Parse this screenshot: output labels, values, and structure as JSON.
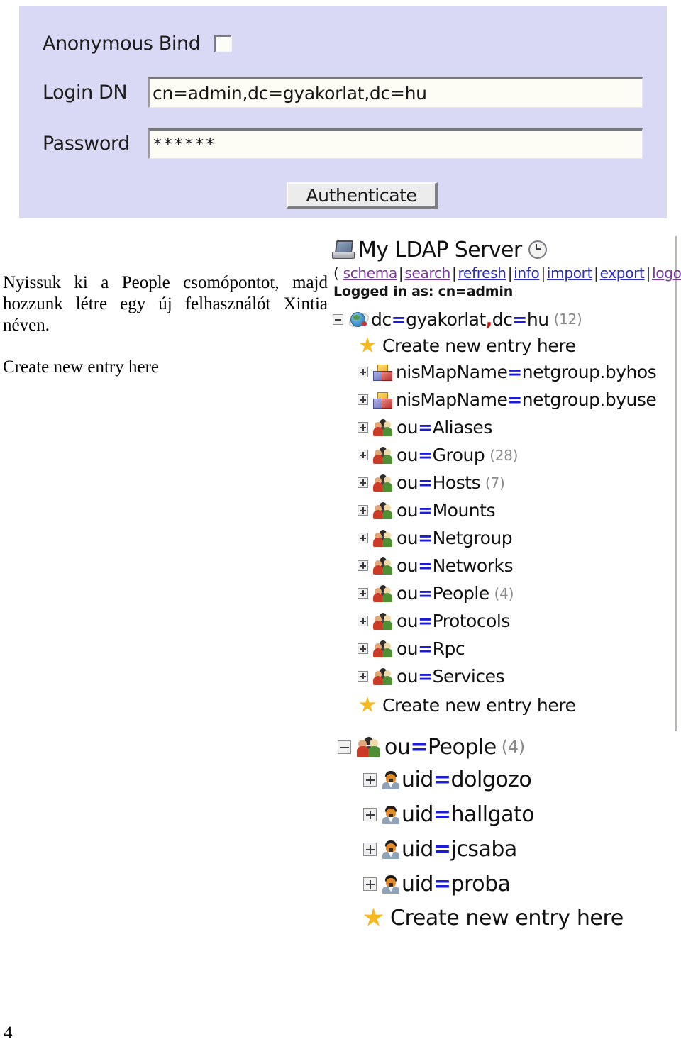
{
  "auth_form": {
    "anonymous_bind_label": "Anonymous Bind",
    "anonymous_bind_checked": false,
    "login_dn_label": "Login DN",
    "login_dn_value": "cn=admin,dc=gyakorlat,dc=hu",
    "password_label": "Password",
    "password_value": "******",
    "authenticate_label": "Authenticate",
    "panel_background": "#d9d9f5"
  },
  "body_text": {
    "paragraph_1": "Nyissuk ki a People csomópontot, majd hozzunk létre egy új felhasználót Xintia néven.",
    "paragraph_2": "Create new entry here"
  },
  "ldap": {
    "server_title": "My LDAP Server",
    "server_icon": "computer-icon",
    "clock_icon": "clock-icon",
    "nav_open_paren": "(",
    "nav_close_paren": ")",
    "nav_separator": "|",
    "nav_links": [
      {
        "label": "schema",
        "state": "visited"
      },
      {
        "label": "search",
        "state": "visited"
      },
      {
        "label": "refresh",
        "state": "fresh"
      },
      {
        "label": "info",
        "state": "fresh"
      },
      {
        "label": "import",
        "state": "fresh"
      },
      {
        "label": "export",
        "state": "fresh"
      },
      {
        "label": "logout",
        "state": "visited"
      }
    ],
    "logged_in_as": "Logged in as: cn=admin",
    "link_visited_color": "#7b38a0",
    "link_color": "#2b2bc8",
    "equals_color": "#1b1bd8",
    "comma_color": "#cc1111",
    "count_color": "#8a8a8a",
    "create_entry_label": "Create new entry here",
    "root": {
      "toggle": "minus",
      "attr": "dc",
      "value": "gyakorlat,dc=hu",
      "text_dc1": "dc",
      "text_gyakorlat": "gyakorlat",
      "text_dc2": "dc",
      "text_hu": "hu",
      "count": "(12)"
    },
    "children": [
      {
        "toggle": "plus",
        "icon": "cubes-icon",
        "attr": "nisMapName",
        "value": "netgroup.byhos",
        "count": ""
      },
      {
        "toggle": "plus",
        "icon": "cubes-icon",
        "attr": "nisMapName",
        "value": "netgroup.byuse",
        "count": ""
      },
      {
        "toggle": "plus",
        "icon": "group-icon",
        "attr": "ou",
        "value": "Aliases",
        "count": ""
      },
      {
        "toggle": "plus",
        "icon": "group-icon",
        "attr": "ou",
        "value": "Group",
        "count": "(28)"
      },
      {
        "toggle": "plus",
        "icon": "group-icon",
        "attr": "ou",
        "value": "Hosts",
        "count": "(7)"
      },
      {
        "toggle": "plus",
        "icon": "group-icon",
        "attr": "ou",
        "value": "Mounts",
        "count": ""
      },
      {
        "toggle": "plus",
        "icon": "group-icon",
        "attr": "ou",
        "value": "Netgroup",
        "count": ""
      },
      {
        "toggle": "plus",
        "icon": "group-icon",
        "attr": "ou",
        "value": "Networks",
        "count": ""
      },
      {
        "toggle": "plus",
        "icon": "group-icon",
        "attr": "ou",
        "value": "People",
        "count": "(4)"
      },
      {
        "toggle": "plus",
        "icon": "group-icon",
        "attr": "ou",
        "value": "Protocols",
        "count": ""
      },
      {
        "toggle": "plus",
        "icon": "group-icon",
        "attr": "ou",
        "value": "Rpc",
        "count": ""
      },
      {
        "toggle": "plus",
        "icon": "group-icon",
        "attr": "ou",
        "value": "Services",
        "count": ""
      }
    ],
    "people_section": {
      "toggle": "minus",
      "icon": "group-icon",
      "attr": "ou",
      "value": "People",
      "count": "(4)",
      "users": [
        {
          "toggle": "plus",
          "icon": "person-icon",
          "attr": "uid",
          "value": "dolgozo"
        },
        {
          "toggle": "plus",
          "icon": "person-icon",
          "attr": "uid",
          "value": "hallgato"
        },
        {
          "toggle": "plus",
          "icon": "person-icon",
          "attr": "uid",
          "value": "jcsaba"
        },
        {
          "toggle": "plus",
          "icon": "person-icon",
          "attr": "uid",
          "value": "proba"
        }
      ]
    }
  },
  "page_number": "4"
}
